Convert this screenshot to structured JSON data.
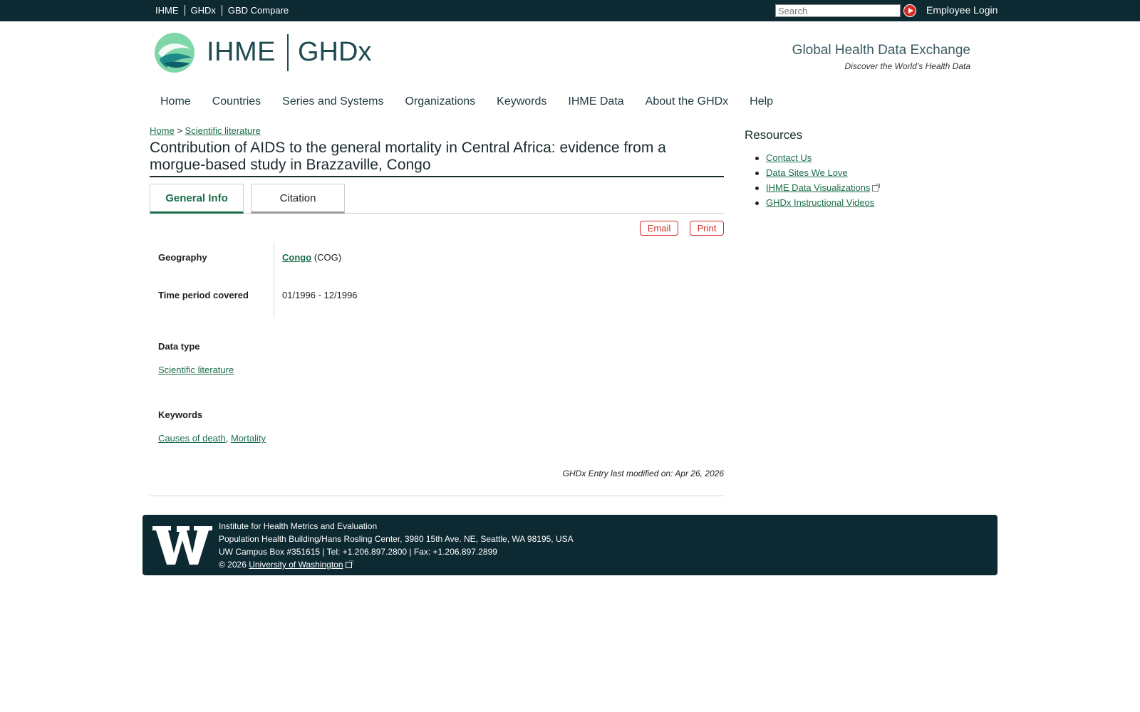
{
  "topnav": {
    "links": [
      "IHME",
      "GHDx",
      "GBD Compare"
    ],
    "search_placeholder": "Search",
    "login": "Employee Login"
  },
  "header": {
    "brand1": "IHME",
    "brand2": "GHDx",
    "tagline": "Global Health Data Exchange",
    "subtag": "Discover the World’s Health Data"
  },
  "mainnav": [
    "Home",
    "Countries",
    "Series and Systems",
    "Organizations",
    "Keywords",
    "IHME Data",
    "About the GHDx",
    "Help"
  ],
  "breadcrumb": {
    "home": "Home",
    "sep": ">",
    "current": "Scientific literature"
  },
  "page_title": "Contribution of AIDS to the general mortality in Central Africa: evidence from a morgue-based study in Brazzaville, Congo",
  "tabs": [
    "General Info",
    "Citation"
  ],
  "actions": {
    "email": "Email",
    "print": "Print"
  },
  "info": {
    "geography_label": "Geography",
    "geography_link": "Congo",
    "geography_code": "(COG)",
    "time_label": "Time period covered",
    "time_value": "01/1996 - 12/1996"
  },
  "data_type": {
    "label": "Data type",
    "value": "Scientific literature"
  },
  "keywords": {
    "label": "Keywords",
    "items": [
      "Causes of death",
      "Mortality"
    ],
    "sep": ","
  },
  "modified": "GHDx Entry last modified on: Apr 26, 2026",
  "sidebar": {
    "title": "Resources",
    "links": [
      "Contact Us",
      "Data Sites We Love",
      "IHME Data Visualizations",
      "GHDx Instructional Videos"
    ]
  },
  "footer": {
    "line1": "Institute for Health Metrics and Evaluation",
    "line2": "Population Health Building/Hans Rosling Center, 3980 15th Ave. NE, Seattle, WA 98195, USA",
    "line3": "UW Campus Box #351615 | Tel: +1.206.897.2800 | Fax: +1.206.897.2899",
    "copyright": "© 2026",
    "uw_link": "University of Washington"
  },
  "colors": {
    "topbar": "#0d2a33",
    "accent_green": "#1a6e4a",
    "action_red": "#d42c26"
  },
  "icons": [
    "search-go-icon",
    "ihme-logo-icon",
    "external-link-icon",
    "uw-logo-icon"
  ]
}
